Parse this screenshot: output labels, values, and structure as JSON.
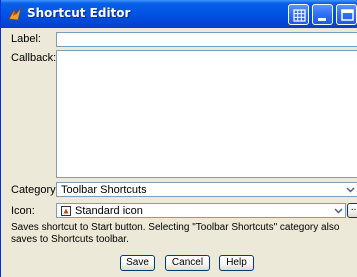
{
  "window": {
    "title": "Shortcut Editor",
    "title_bar_color": "#0055e5"
  },
  "form": {
    "label_label": "Label:",
    "label_value": "",
    "callback_label": "Callback:",
    "callback_value": "",
    "category_label": "Category:",
    "category_value": "Toolbar Shortcuts",
    "icon_label": "Icon:",
    "icon_value": "Standard icon",
    "browse_label": "...",
    "help_text": "Saves shortcut to Start button. Selecting \"Toolbar Shortcuts\" category also saves to Shortcuts toolbar."
  },
  "buttons": {
    "save": "Save",
    "cancel": "Cancel",
    "help": "Help"
  },
  "icons": {
    "app": "matlab-icon",
    "grid": "grid-icon",
    "minimize": "minimize-icon",
    "maximize": "maximize-icon",
    "close": "close-icon",
    "dropdown": "chevron-down-icon",
    "standard": "standard-icon"
  }
}
